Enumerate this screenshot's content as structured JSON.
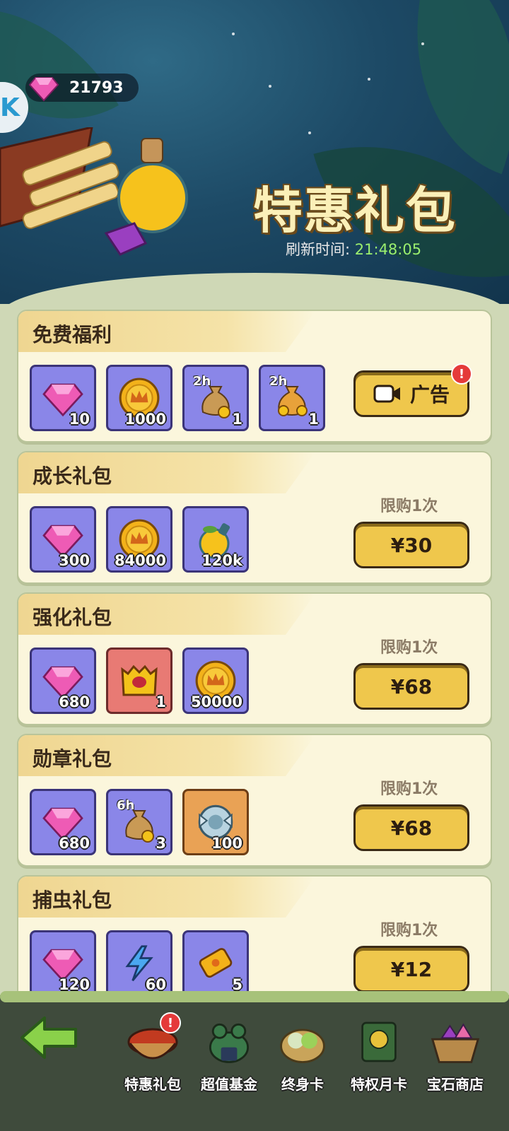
{
  "header": {
    "gem_count": "21793",
    "title": "特惠礼包",
    "refresh_label": "刷新时间:",
    "refresh_time": "21:48:05"
  },
  "packs": [
    {
      "title": "免费福利",
      "button": "广告",
      "button_icon": "video-ad-icon",
      "items": [
        {
          "icon": "gem-icon",
          "qty": "10"
        },
        {
          "icon": "gold-coin-icon",
          "qty": "1000"
        },
        {
          "icon": "gold-bag-icon",
          "qty": "1",
          "tag": "2h"
        },
        {
          "icon": "fruit-bag-icon",
          "qty": "1",
          "tag": "2h"
        }
      ]
    },
    {
      "title": "成长礼包",
      "limit": "限购1次",
      "button": "¥30",
      "items": [
        {
          "icon": "gem-icon",
          "qty": "300"
        },
        {
          "icon": "gold-coin-icon",
          "qty": "84000"
        },
        {
          "icon": "lemon-potion-icon",
          "qty": "120k"
        }
      ]
    },
    {
      "title": "强化礼包",
      "limit": "限购1次",
      "button": "¥68",
      "items": [
        {
          "icon": "gem-icon",
          "qty": "680"
        },
        {
          "icon": "treasure-chest-icon",
          "qty": "1"
        },
        {
          "icon": "gold-coin-icon",
          "qty": "50000"
        }
      ]
    },
    {
      "title": "勋章礼包",
      "limit": "限购1次",
      "button": "¥68",
      "items": [
        {
          "icon": "gem-icon",
          "qty": "680"
        },
        {
          "icon": "gold-bag-icon",
          "qty": "3",
          "tag": "6h"
        },
        {
          "icon": "medal-icon",
          "qty": "100"
        }
      ]
    },
    {
      "title": "捕虫礼包",
      "limit": "限购1次",
      "button": "¥12",
      "items": [
        {
          "icon": "gem-icon",
          "qty": "120"
        },
        {
          "icon": "lightning-icon",
          "qty": "60"
        },
        {
          "icon": "ticket-icon",
          "qty": "5"
        }
      ]
    }
  ],
  "nav": {
    "back_icon": "back-arrow-icon",
    "tabs": [
      {
        "label": "特惠礼包",
        "icon": "bowl-icon",
        "active": true,
        "badge": "!"
      },
      {
        "label": "超值基金",
        "icon": "frog-icon"
      },
      {
        "label": "终身卡",
        "icon": "fruit-basket-icon"
      },
      {
        "label": "特权月卡",
        "icon": "stone-tablet-icon"
      },
      {
        "label": "宝石商店",
        "icon": "gem-basket-icon"
      }
    ]
  },
  "colors": {
    "card_bg": "#fbf6dc",
    "item_bg": "#8a86e8",
    "button_bg": "#efc74c",
    "title_text": "#fbf0b8",
    "refresh_time": "#9bef6e"
  }
}
